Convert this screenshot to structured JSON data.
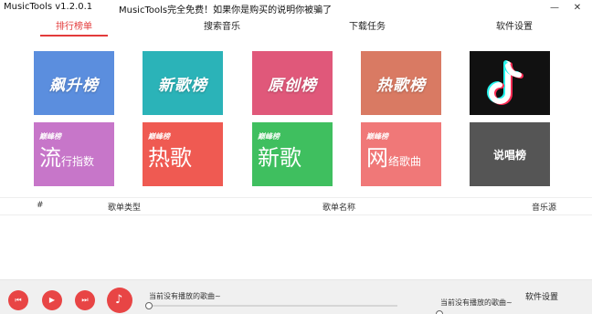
{
  "window": {
    "app_name": "MusicTools  v1.2.0.1",
    "notice": "MusicTools完全免费！如果你是购买的说明你被骗了",
    "minimize_icon": "minimize-icon",
    "close_icon": "close-icon",
    "minimize_glyph": "—",
    "close_glyph": "✕"
  },
  "tabs": [
    {
      "label": "排行榜单",
      "active": true
    },
    {
      "label": "搜索音乐",
      "active": false
    },
    {
      "label": "下载任务",
      "active": false
    },
    {
      "label": "软件设置",
      "active": false
    }
  ],
  "tiles_row1": [
    {
      "label": "飙升榜",
      "color": "#5b8ede"
    },
    {
      "label": "新歌榜",
      "color": "#2bb3b8"
    },
    {
      "label": "原创榜",
      "color": "#e0587a"
    },
    {
      "label": "热歌榜",
      "color": "#d97a63"
    },
    {
      "label": "",
      "icon": "tiktok-logo-icon",
      "color": "#111111"
    }
  ],
  "tiles_row2": [
    {
      "badge": "巅峰榜",
      "big": "流",
      "rest": "行指数",
      "color": "#c776c9"
    },
    {
      "badge": "巅峰榜",
      "big": "热歌",
      "rest": "",
      "color": "#ef5a52"
    },
    {
      "badge": "巅峰榜",
      "big": "新歌",
      "rest": "",
      "color": "#3fbf5f"
    },
    {
      "badge": "巅峰榜",
      "big": "网",
      "rest": "络歌曲",
      "color": "#f07878"
    },
    {
      "label": "说唱榜",
      "color": "#555555"
    }
  ],
  "table": {
    "col_index": "#",
    "col_type": "歌单类型",
    "col_name": "歌单名称",
    "col_source": "音乐源"
  },
  "player": {
    "prev_icon": "previous-icon",
    "play_icon": "play-icon",
    "next_icon": "next-icon",
    "disc_icon": "music-note-icon",
    "prev_glyph": "⏮",
    "play_glyph": "▶",
    "next_glyph": "⏭",
    "disc_glyph": "♪",
    "now_playing": "当前没有播放的歌曲~",
    "now_playing_right": "当前没有播放的歌曲~",
    "software_label": "软件设置",
    "progress": 0,
    "volume": 0
  }
}
